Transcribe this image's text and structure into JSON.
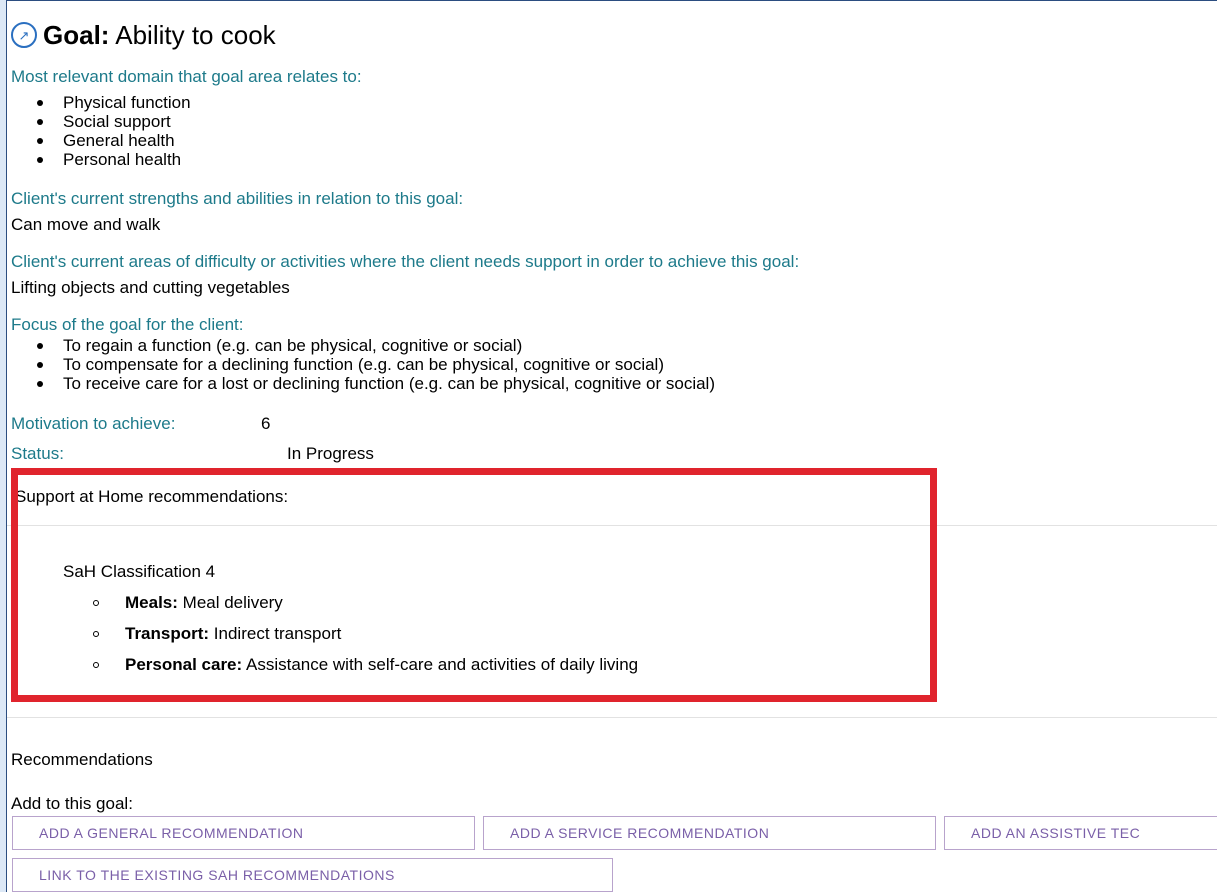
{
  "goal": {
    "label": "Goal:",
    "name": "Ability to cook",
    "icon": "goal-arrows-icon"
  },
  "domain": {
    "heading": "Most relevant domain that goal area relates to:",
    "items": [
      "Physical function",
      "Social support",
      "General health",
      "Personal health"
    ]
  },
  "strengths": {
    "heading": "Client's current strengths and abilities in relation to this goal:",
    "value": "Can move and walk"
  },
  "difficulty": {
    "heading": "Client's current areas of difficulty or activities where the client needs support in order to achieve this goal:",
    "value": "Lifting objects and cutting vegetables"
  },
  "focus": {
    "heading": "Focus of the goal for the client:",
    "items": [
      "To regain a function (e.g. can be physical, cognitive or social)",
      "To compensate for a declining function (e.g. can be physical, cognitive or social)",
      "To receive care for a lost or declining function (e.g. can be physical, cognitive or social)"
    ]
  },
  "motivation": {
    "label": "Motivation to achieve:",
    "value": "6"
  },
  "status": {
    "label": "Status:",
    "value": "In Progress"
  },
  "sah": {
    "heading": "Support at Home recommendations:",
    "classification": "SaH Classification 4",
    "items": [
      {
        "label": "Meals:",
        "value": "Meal delivery"
      },
      {
        "label": "Transport:",
        "value": "Indirect transport"
      },
      {
        "label": "Personal care:",
        "value": "Assistance with self-care and activities of daily living"
      }
    ]
  },
  "recommendations": {
    "heading": "Recommendations",
    "add_label": "Add to this goal:",
    "buttons": [
      "ADD A GENERAL RECOMMENDATION",
      "ADD A SERVICE RECOMMENDATION",
      "ADD AN ASSISTIVE TEC",
      "LINK TO THE EXISTING SAH RECOMMENDATIONS"
    ]
  },
  "colors": {
    "label_teal": "#1d7a8a",
    "highlight_red": "#e0242d",
    "button_purple": "#7a5fa8"
  }
}
